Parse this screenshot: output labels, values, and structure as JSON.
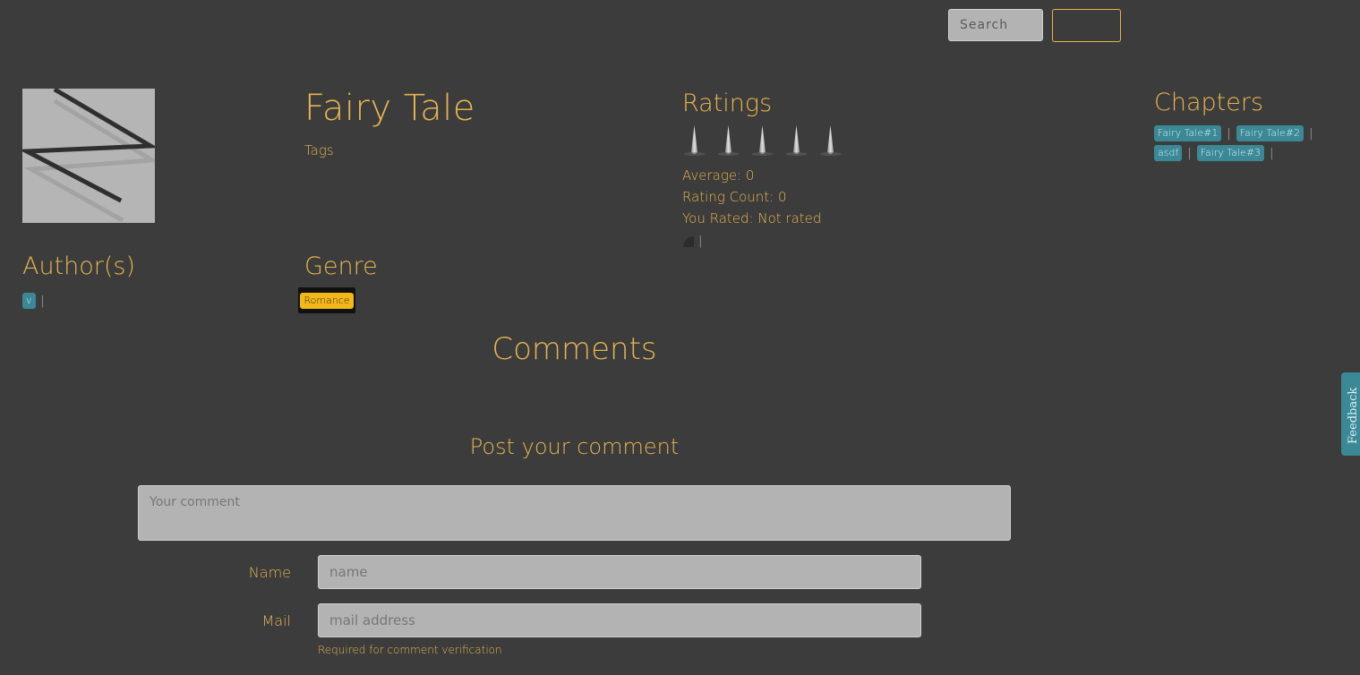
{
  "header": {
    "search_placeholder": "Search",
    "search_button_label": ""
  },
  "story": {
    "title": "Fairy Tale",
    "tags_label": "Tags"
  },
  "ratings": {
    "title": "Ratings",
    "star_count": 5,
    "average": "Average: 0",
    "rating_count": "Rating Count: 0",
    "you_rated": "You Rated: Not rated",
    "separator": "|"
  },
  "chapters": {
    "title": "Chapters",
    "items": [
      {
        "label": "Fairy Tale#1"
      },
      {
        "label": "Fairy Tale#2"
      },
      {
        "label": "asdf"
      },
      {
        "label": "Fairy Tale#3"
      }
    ],
    "separator": "|"
  },
  "authors": {
    "title": "Author(s)",
    "items": [
      {
        "label": "v"
      }
    ],
    "separator": "|"
  },
  "genre": {
    "title": "Genre",
    "items": [
      {
        "label": "Romance"
      }
    ]
  },
  "comments": {
    "title": "Comments",
    "post_title": "Post your comment",
    "comment_placeholder": "Your comment",
    "name_label": "Name",
    "name_placeholder": "name",
    "mail_label": "Mail",
    "mail_placeholder": "mail address",
    "mail_hint": "Required for comment verification"
  },
  "feedback": {
    "label": "Feedback"
  },
  "colors": {
    "background": "#3c3c3c",
    "accent": "#e6b450",
    "chip": "#3b8896",
    "genre_chip": "#f2b81a"
  }
}
